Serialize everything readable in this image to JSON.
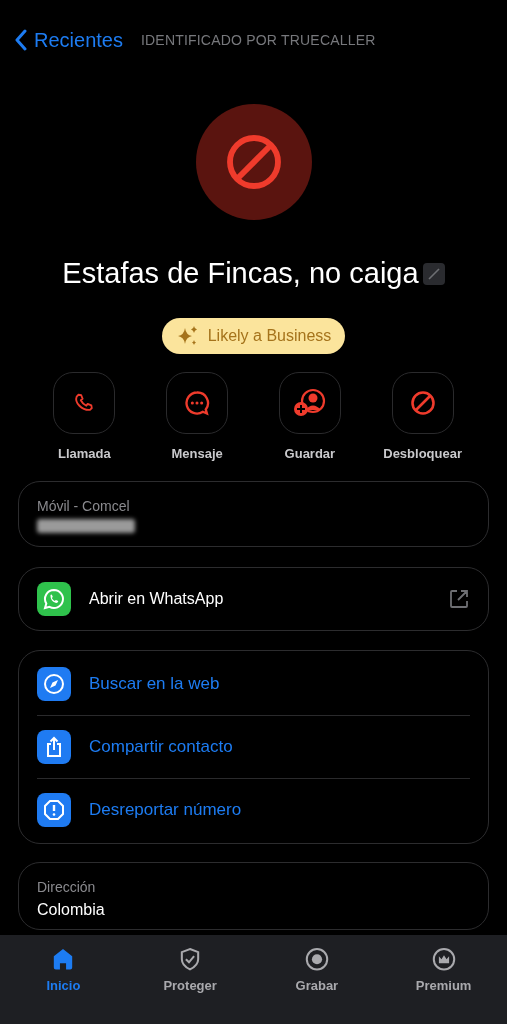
{
  "header": {
    "back_label": "Recientes",
    "subtitle": "IDENTIFICADO POR TRUECALLER"
  },
  "profile": {
    "name": "Estafas de Fincas, no caiga",
    "badge": "Likely a Business"
  },
  "actions": [
    {
      "label": "Llamada"
    },
    {
      "label": "Mensaje"
    },
    {
      "label": "Guardar"
    },
    {
      "label": "Desbloquear"
    }
  ],
  "phone_card": {
    "label": "Móvil - Comcel"
  },
  "whatsapp": {
    "label": "Abrir en WhatsApp"
  },
  "links": [
    {
      "label": "Buscar en la web"
    },
    {
      "label": "Compartir contacto"
    },
    {
      "label": "Desreportar número"
    }
  ],
  "address": {
    "label": "Dirección",
    "value": "Colombia"
  },
  "tab_bar": [
    {
      "label": "Inicio",
      "selected": true
    },
    {
      "label": "Proteger",
      "selected": false
    },
    {
      "label": "Grabar",
      "selected": false
    },
    {
      "label": "Premium",
      "selected": false
    }
  ]
}
